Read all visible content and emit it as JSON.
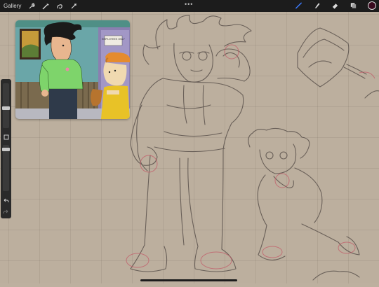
{
  "toolbar": {
    "gallery_label": "Gallery",
    "center_menu": "•••",
    "left_tools": [
      "wrench-icon",
      "magic-wand-icon",
      "selection-icon",
      "transform-icon"
    ],
    "right_tools": [
      "brush-icon",
      "smudge-icon",
      "eraser-icon",
      "layers-icon",
      "color-swatch"
    ],
    "active_tool": "brush",
    "active_color": "#3a0a1f",
    "brush_color_accent": "#3c7bff"
  },
  "reference": {
    "sign_text": "EMPLOYEES ONLY"
  },
  "sidebar": {
    "size_level": 0.7,
    "opacity_level": 0.6
  }
}
